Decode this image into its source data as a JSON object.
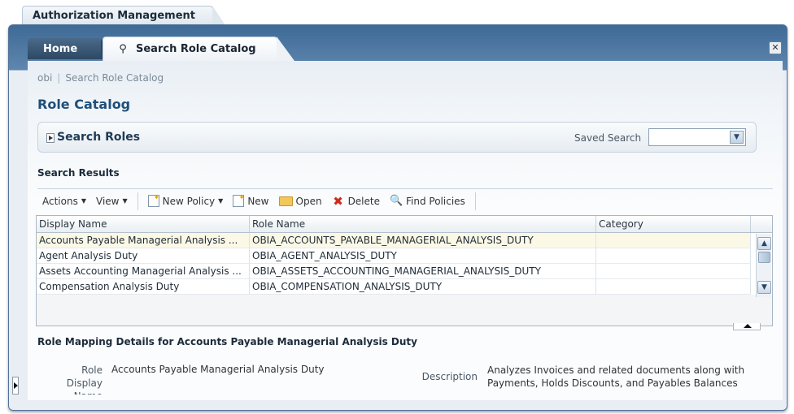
{
  "app": {
    "title": "Authorization Management"
  },
  "tabs": [
    {
      "label": "Home"
    },
    {
      "label": "Search Role Catalog"
    }
  ],
  "breadcrumb": {
    "items": [
      "obi",
      "Search Role Catalog"
    ]
  },
  "page": {
    "title": "Role Catalog"
  },
  "search_panel": {
    "title": "Search Roles",
    "saved_search_label": "Saved Search",
    "saved_search_value": ""
  },
  "results": {
    "title": "Search Results",
    "toolbar": {
      "actions": "Actions",
      "view": "View",
      "new_policy": "New Policy",
      "new": "New",
      "open": "Open",
      "delete": "Delete",
      "find_policies": "Find Policies"
    },
    "columns": [
      "Display Name",
      "Role Name",
      "Category"
    ],
    "rows": [
      {
        "display_name": "Accounts Payable Managerial Analysis ...",
        "role_name": "OBIA_ACCOUNTS_PAYABLE_MANAGERIAL_ANALYSIS_DUTY",
        "category": ""
      },
      {
        "display_name": "Agent Analysis Duty",
        "role_name": "OBIA_AGENT_ANALYSIS_DUTY",
        "category": ""
      },
      {
        "display_name": "Assets Accounting Managerial Analysis ...",
        "role_name": "OBIA_ASSETS_ACCOUNTING_MANAGERIAL_ANALYSIS_DUTY",
        "category": ""
      },
      {
        "display_name": "Compensation Analysis Duty",
        "role_name": "OBIA_COMPENSATION_ANALYSIS_DUTY",
        "category": ""
      }
    ]
  },
  "details": {
    "title": "Role Mapping Details for Accounts Payable Managerial Analysis Duty",
    "role_display_label_1": "Role",
    "role_display_label_2": "Display",
    "role_display_label_3": "Name",
    "role_display_value": "Accounts Payable Managerial Analysis Duty",
    "description_label": "Description",
    "description_line_1": "Analyzes Invoices and related documents along with",
    "description_line_2": "Payments, Holds Discounts, and Payables Balances"
  },
  "colors": {
    "header_blue": "#3e6a96",
    "title_blue": "#1f4f79",
    "selected_row": "#fbf8e6"
  }
}
